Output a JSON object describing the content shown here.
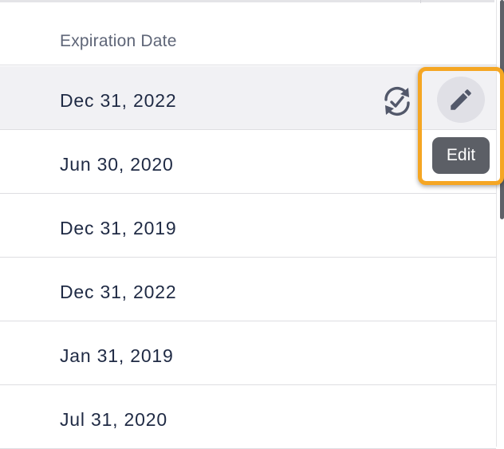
{
  "table": {
    "header": {
      "expiration_date": "Expiration Date"
    },
    "rows": [
      {
        "expiration_date": "Dec 31, 2022"
      },
      {
        "expiration_date": "Jun 30, 2020"
      },
      {
        "expiration_date": "Dec 31, 2019"
      },
      {
        "expiration_date": "Dec 31, 2022"
      },
      {
        "expiration_date": "Jan 31, 2019"
      },
      {
        "expiration_date": "Jul 31, 2020"
      }
    ]
  },
  "row_actions": {
    "renew_icon": "renew-icon",
    "edit_icon": "pencil-icon",
    "edit_tooltip": "Edit"
  },
  "colors": {
    "highlight": "#f5a623",
    "hover_row": "#f1f1f4",
    "text": "#1f2a44",
    "header_text": "#5e6577",
    "tooltip_bg": "#5c5f66"
  }
}
